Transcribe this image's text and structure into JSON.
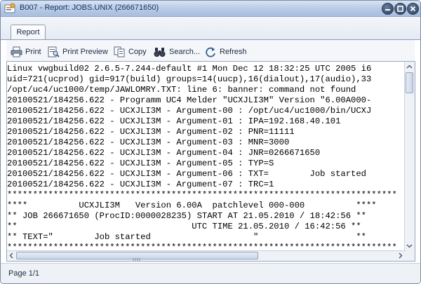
{
  "window": {
    "title": "B007 - Report: JOBS.UNIX (266671650)",
    "accent": "#b9cbe6"
  },
  "tabs": [
    {
      "label": "Report",
      "selected": true
    }
  ],
  "toolbar": {
    "print": "Print",
    "print_preview": "Print Preview",
    "copy": "Copy",
    "search": "Search...",
    "refresh": "Refresh"
  },
  "report": {
    "lines": [
      "Linux vwgbuild02 2.6.5-7.244-default #1 Mon Dec 12 18:32:25 UTC 2005 i6",
      "uid=721(ucprod) gid=917(build) groups=14(uucp),16(dialout),17(audio),33",
      "/opt/uc4/uc1000/temp/JAWLOMRY.TXT: line 6: banner: command not found",
      "20100521/184256.622 - Programm UC4 Melder \"UCXJLI3M\" Version \"6.00A000-",
      "20100521/184256.622 - UCXJLI3M - Argument-00 : /opt/uc4/uc1000/bin/UCXJ",
      "20100521/184256.622 - UCXJLI3M - Argument-01 : IPA=192.168.40.101",
      "20100521/184256.622 - UCXJLI3M - Argument-02 : PNR=11111",
      "20100521/184256.622 - UCXJLI3M - Argument-03 : MNR=3000",
      "20100521/184256.622 - UCXJLI3M - Argument-04 : JNR=0266671650",
      "20100521/184256.622 - UCXJLI3M - Argument-05 : TYP=S",
      "20100521/184256.622 - UCXJLI3M - Argument-06 : TXT=        Job started",
      "20100521/184256.622 - UCXJLI3M - Argument-07 : TRC=1",
      "****************************************************************************",
      "****          UCXJLI3M   Version 6.00A  patchlevel 000-000          ****",
      "** JOB 266671650 (ProcID:0000028235) START AT 21.05.2010 / 18:42:56 **",
      "**                                  UTC TIME 21.05.2010 / 16:42:56 **",
      "** TEXT=\"        Job started                    \"                   **",
      "****************************************************************************"
    ]
  },
  "status": {
    "page": "Page 1/1"
  }
}
